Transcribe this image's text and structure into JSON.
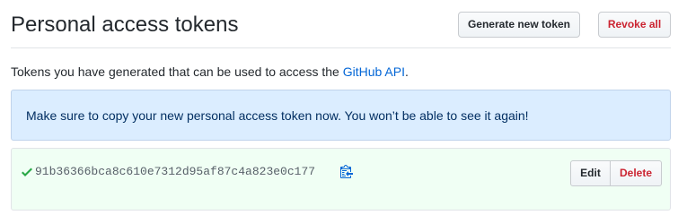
{
  "header": {
    "title": "Personal access tokens",
    "generate_label": "Generate new token",
    "revoke_label": "Revoke all"
  },
  "description": {
    "text": "Tokens you have generated that can be used to access the ",
    "link_text": "GitHub API",
    "suffix": "."
  },
  "flash": {
    "message": "Make sure to copy your new personal access token now. You won’t be able to see it again!"
  },
  "token": {
    "value": "91b36366bca8c610e7312d95af87c4a823e0c177",
    "status_icon": "check-icon",
    "copy_icon": "clipboard-icon",
    "edit_label": "Edit",
    "delete_label": "Delete"
  },
  "colors": {
    "link": "#0366d6",
    "danger": "#cb2431",
    "success": "#28a745",
    "flash_bg": "#dbedff",
    "token_bg": "#f0fff4"
  }
}
